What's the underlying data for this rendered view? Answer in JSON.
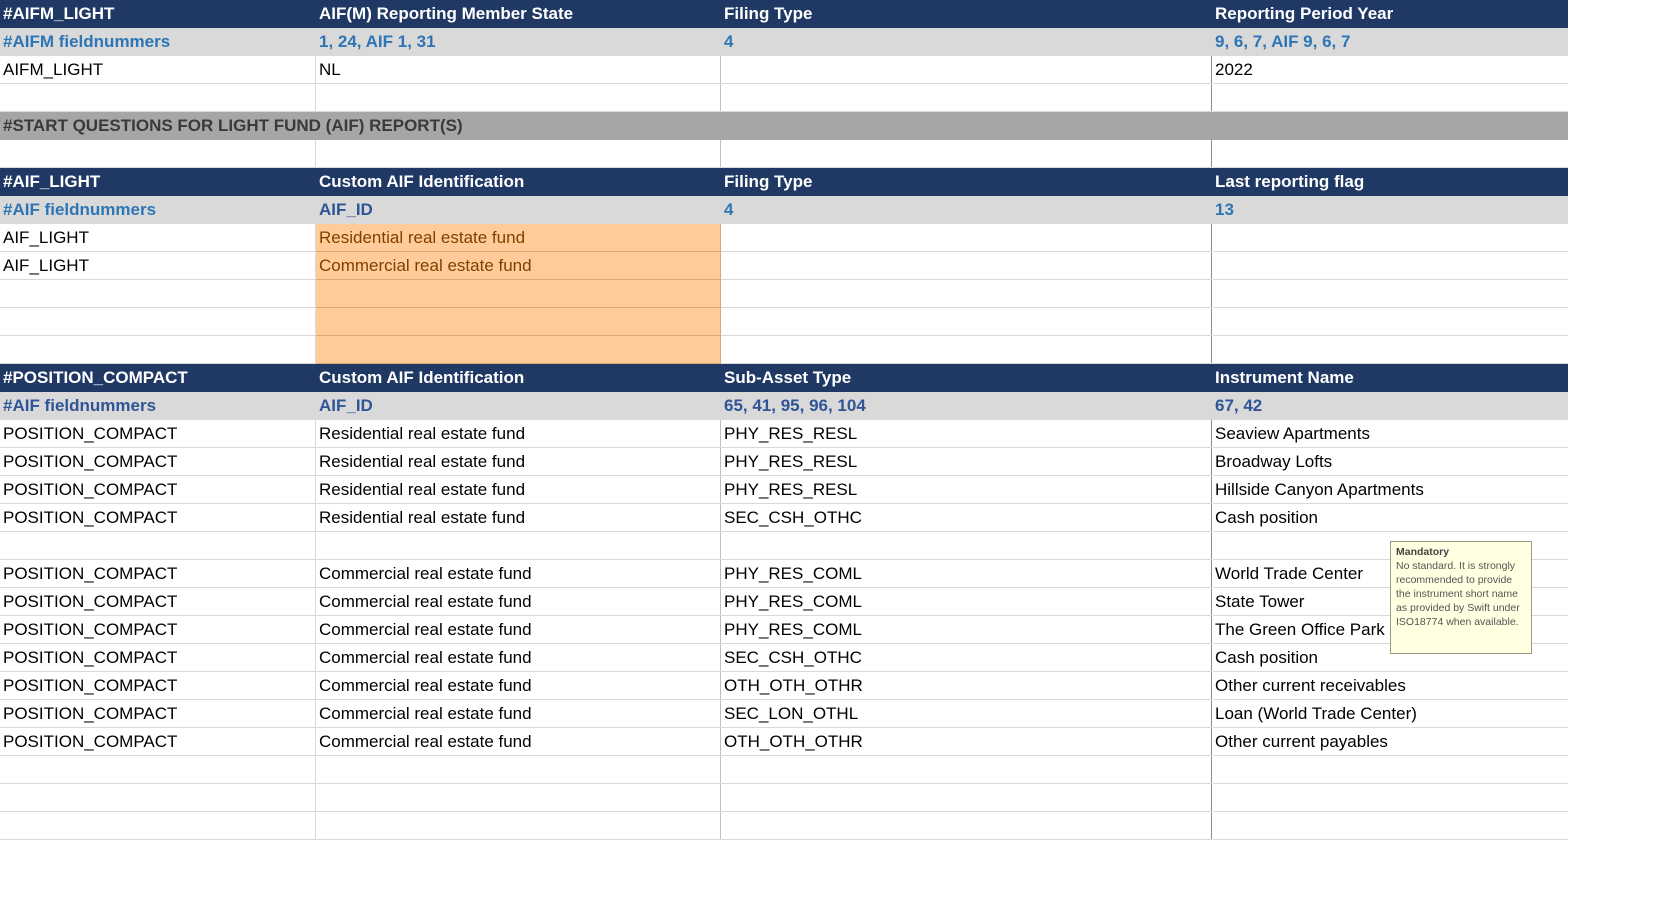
{
  "aifm": {
    "header": [
      "#AIFM_LIGHT",
      "AIF(M) Reporting Member State",
      "Filing Type",
      "Reporting Period Year"
    ],
    "fieldnumbers": [
      "#AIFM fieldnummers",
      "1, 24, AIF 1, 31",
      "4",
      "9, 6, 7, AIF 9, 6, 7"
    ],
    "row": [
      "AIFM_LIGHT",
      "NL",
      "",
      "2022"
    ]
  },
  "section_title": "#START QUESTIONS FOR LIGHT FUND (AIF) REPORT(S)",
  "aif": {
    "header": [
      "#AIF_LIGHT",
      "Custom AIF Identification",
      "Filing Type",
      "Last reporting flag"
    ],
    "fieldnumbers": [
      "#AIF fieldnummers",
      "AIF_ID",
      "4",
      "13"
    ],
    "rows": [
      [
        "AIF_LIGHT",
        "Residential real estate fund",
        "",
        ""
      ],
      [
        "AIF_LIGHT",
        "Commercial real estate fund",
        "",
        ""
      ],
      [
        "",
        "",
        "",
        ""
      ],
      [
        "",
        "",
        "",
        ""
      ],
      [
        "",
        "",
        "",
        ""
      ]
    ]
  },
  "position": {
    "header": [
      "#POSITION_COMPACT",
      "Custom AIF Identification",
      "Sub-Asset Type",
      "Instrument Name"
    ],
    "fieldnumbers": [
      "#AIF fieldnummers",
      "AIF_ID",
      "65, 41, 95, 96, 104",
      "67, 42"
    ],
    "rows": [
      [
        "POSITION_COMPACT",
        "Residential real estate fund",
        "PHY_RES_RESL",
        "Seaview Apartments"
      ],
      [
        "POSITION_COMPACT",
        "Residential real estate fund",
        "PHY_RES_RESL",
        "Broadway Lofts"
      ],
      [
        "POSITION_COMPACT",
        "Residential real estate fund",
        "PHY_RES_RESL",
        "Hillside Canyon Apartments"
      ],
      [
        "POSITION_COMPACT",
        "Residential real estate fund",
        "SEC_CSH_OTHC",
        "Cash position"
      ],
      [
        "",
        "",
        "",
        ""
      ],
      [
        "POSITION_COMPACT",
        "Commercial real estate fund",
        "PHY_RES_COML",
        "World Trade Center"
      ],
      [
        "POSITION_COMPACT",
        "Commercial real estate fund",
        "PHY_RES_COML",
        "State Tower"
      ],
      [
        "POSITION_COMPACT",
        "Commercial real estate fund",
        "PHY_RES_COML",
        "The Green Office Park"
      ],
      [
        "POSITION_COMPACT",
        "Commercial real estate fund",
        "SEC_CSH_OTHC",
        "Cash position"
      ],
      [
        "POSITION_COMPACT",
        "Commercial real estate fund",
        "OTH_OTH_OTHR",
        "Other current receivables"
      ],
      [
        "POSITION_COMPACT",
        "Commercial real estate fund",
        "SEC_LON_OTHL",
        "Loan (World Trade Center)"
      ],
      [
        "POSITION_COMPACT",
        "Commercial real estate fund",
        "OTH_OTH_OTHR",
        "Other current payables"
      ],
      [
        "",
        "",
        "",
        ""
      ],
      [
        "",
        "",
        "",
        ""
      ],
      [
        "",
        "",
        "",
        ""
      ]
    ]
  },
  "tooltip": {
    "title": "Mandatory",
    "body": "No standard. It is strongly recommended to provide the instrument short name as provided by Swift under ISO18774 when available."
  },
  "colors": {
    "header_bg": "#1f3864",
    "fieldnumber_bg": "#d9d9d9",
    "fieldnumber_text": "#2e75b6",
    "section_bg": "#a6a6a6",
    "input_cell_bg": "#ffcc99",
    "tooltip_bg": "#ffffe1"
  }
}
